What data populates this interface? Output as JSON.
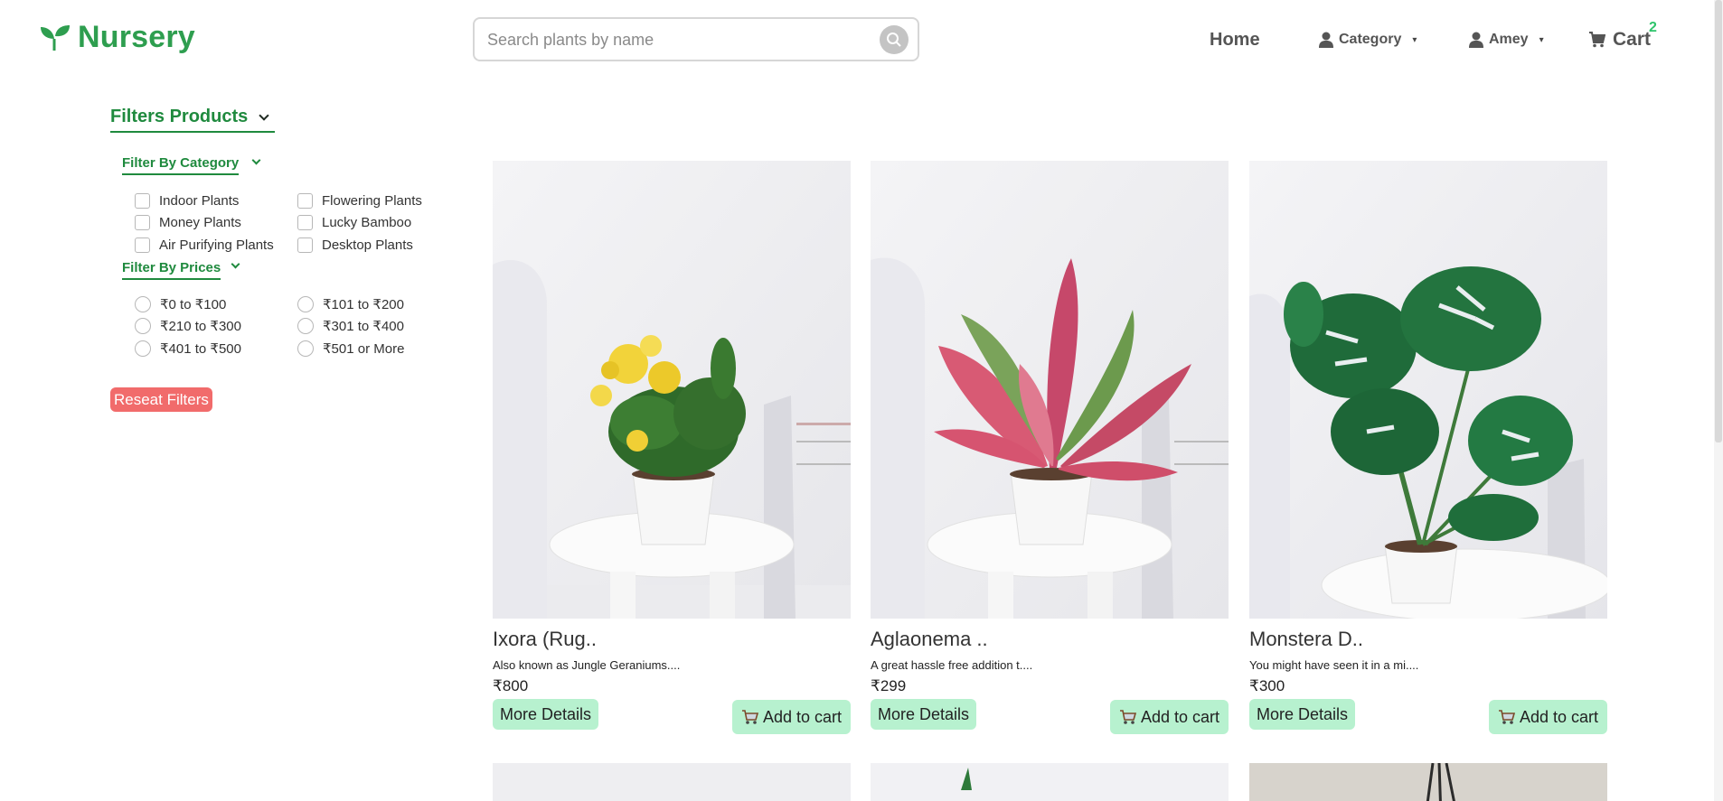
{
  "brand": {
    "name": "Nursery",
    "icon": "sprout-icon",
    "color": "#2e9e4f"
  },
  "search": {
    "placeholder": "Search plants by name",
    "value": "",
    "button_icon": "search-icon"
  },
  "nav": {
    "home": "Home",
    "category": "Category",
    "user": "Amey",
    "cart": "Cart",
    "cart_count": "2"
  },
  "filters": {
    "title": "Filters Products",
    "category_title": "Filter By Category",
    "categories": [
      "Indoor Plants",
      "Flowering Plants",
      "Money Plants",
      "Lucky Bamboo",
      "Air Purifying Plants",
      "Desktop Plants"
    ],
    "price_title": "Filter By Prices",
    "prices": [
      "₹0 to ₹100",
      "₹101 to ₹200",
      "₹210 to ₹300",
      "₹301 to ₹400",
      "₹401 to ₹500",
      "₹501 or More"
    ],
    "reset_label": "Reseat Filters"
  },
  "products": [
    {
      "name": "Ixora (Rug..",
      "desc": "Also known as Jungle Geraniums....",
      "price": "₹800",
      "details_label": "More Details",
      "cart_label": "Add to cart"
    },
    {
      "name": "Aglaonema ..",
      "desc": "A great hassle free addition t....",
      "price": "₹299",
      "details_label": "More Details",
      "cart_label": "Add to cart"
    },
    {
      "name": "Monstera D..",
      "desc": "You might have seen it in a mi....",
      "price": "₹300",
      "details_label": "More Details",
      "cart_label": "Add to cart"
    }
  ],
  "colors": {
    "accent": "#1f8a3e",
    "button_bg": "#b7f1cf",
    "reset_bg": "#f16b6b",
    "cart_badge": "#2ec46b"
  }
}
